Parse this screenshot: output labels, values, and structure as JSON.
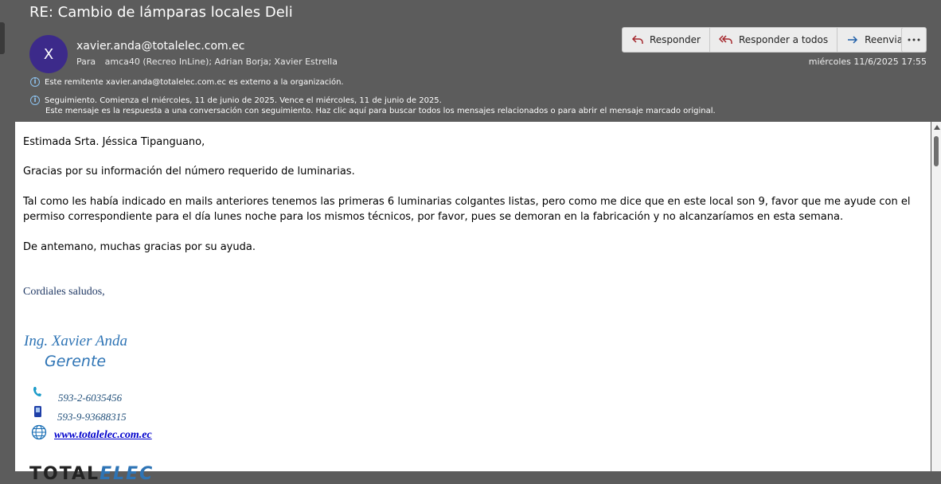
{
  "header": {
    "subject": "RE: Cambio de lámparas locales Deli",
    "avatar_initial": "X",
    "from": "xavier.anda@totalelec.com.ec",
    "to_label": "Para",
    "to_value": "amca40 (Recreo InLine); Adrian Borja; Xavier Estrella",
    "date": "miércoles 11/6/2025 17:55",
    "info_external": "Este remitente xavier.anda@totalelec.com.ec es externo a la organización.",
    "info_followup": "Seguimiento.  Comienza el miércoles, 11 de junio de 2025.  Vence el miércoles, 11 de junio de 2025.",
    "info_followup_2": "Este mensaje es la respuesta a una conversación con seguimiento. Haz clic aquí para buscar todos los mensajes relacionados o para abrir el mensaje marcado original."
  },
  "actions": {
    "reply": "Responder",
    "reply_all": "Responder a todos",
    "forward": "Reenviar"
  },
  "body": {
    "greeting": "Estimada Srta. Jéssica Tipanguano,",
    "p1": "Gracias por su información del número requerido de luminarias.",
    "p2": "Tal como les había indicado en mails anteriores tenemos las primeras 6 luminarias colgantes listas, pero como me dice que en este local son 9, favor que me ayude con el permiso correspondiente para el día lunes noche para los mismos técnicos, por favor, pues se demoran en la fabricación y no alcanzaríamos en esta semana.",
    "p3": "De antemano, muchas gracias por su ayuda.",
    "closing": "Cordiales saludos,"
  },
  "signature": {
    "name": "Ing. Xavier Anda",
    "role": "Gerente",
    "phone": "593-2-6035456",
    "mobile": "593-9-93688315",
    "web": "www.totalelec.com.ec",
    "logo_a": "TOTAL",
    "logo_b": "ELEC"
  },
  "icons": [
    "info-icon",
    "reply-icon",
    "reply-all-icon",
    "forward-icon",
    "more-icon",
    "phone-icon",
    "mobile-icon",
    "globe-icon"
  ],
  "colors": {
    "header_bg": "#5c5c5c",
    "avatar": "#3c2a8a",
    "signature_blue": "#2e74b5",
    "closing_navy": "#1f3864"
  }
}
